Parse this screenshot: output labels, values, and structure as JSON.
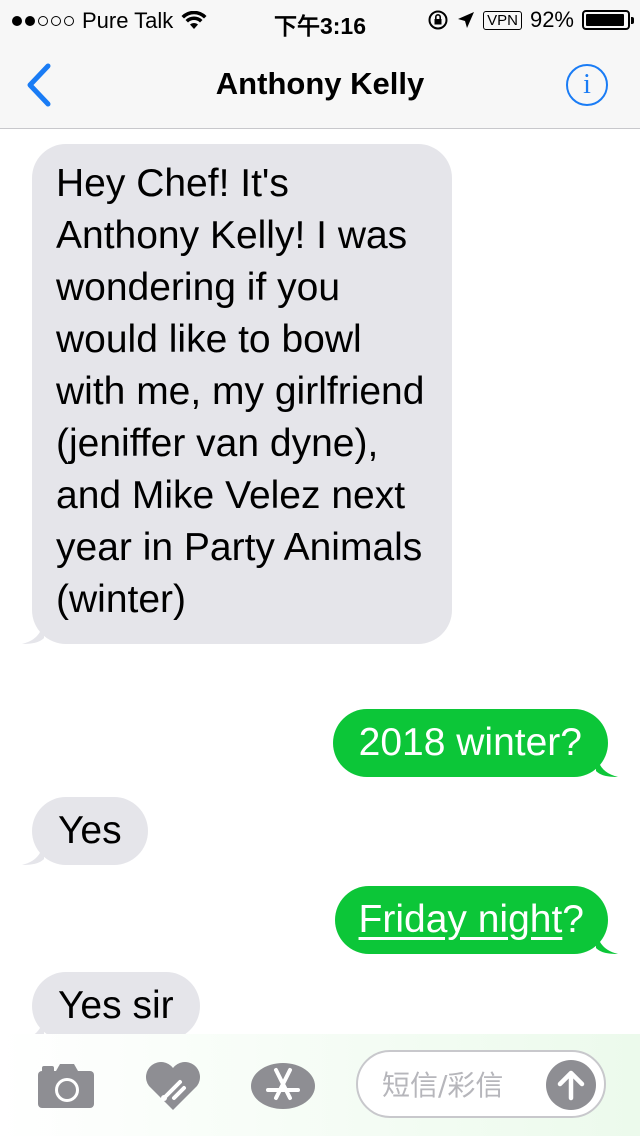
{
  "status_bar": {
    "carrier": "Pure Talk",
    "time": "下午3:16",
    "vpn": "VPN",
    "battery_percent": "92%",
    "battery_level": 0.92,
    "signal_bars": 2
  },
  "nav": {
    "title": "Anthony Kelly",
    "info_glyph": "i",
    "back_icon": "chevron-left-icon"
  },
  "messages": [
    {
      "direction": "incoming",
      "text": "Hey Chef! It's Anthony Kelly! I was wondering if you would like to bowl with me, my girlfriend (jeniffer van dyne), and Mike Velez next year in Party Animals (winter)"
    },
    {
      "direction": "outgoing",
      "text": "2018 winter?"
    },
    {
      "direction": "incoming",
      "text": "Yes"
    },
    {
      "direction": "outgoing",
      "link_text": "Friday night",
      "suffix": "?"
    },
    {
      "direction": "incoming",
      "text": "Yes sir"
    }
  ],
  "input_bar": {
    "placeholder": "短信/彩信",
    "icons": [
      "camera-icon",
      "digital-touch-icon",
      "app-store-icon",
      "arrow-up-icon"
    ]
  },
  "colors": {
    "incoming_bubble": "#e5e5ea",
    "outgoing_bubble": "#0cc638",
    "accent": "#1a7cf5"
  }
}
